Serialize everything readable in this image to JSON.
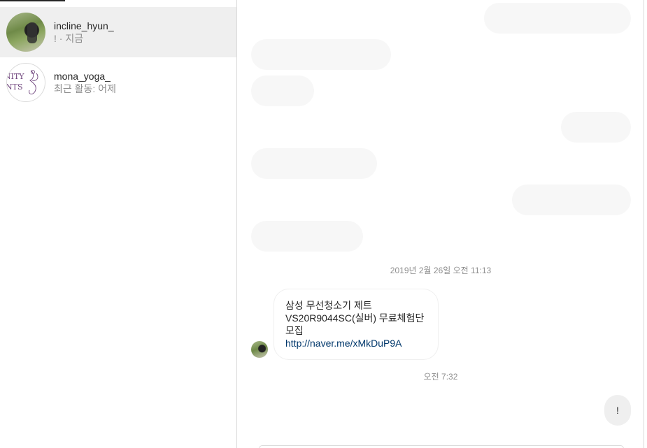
{
  "conversations": [
    {
      "name": "incline_hyun_",
      "status": "! · 지금",
      "avatar_icon": "profile-photo",
      "active": true
    },
    {
      "name": "mona_yoga_",
      "status": "최근 활동: 어제",
      "avatar_icon": "brand-logo",
      "logo_text_line1": "NITY",
      "logo_text_line2": "NTS"
    }
  ],
  "thread": {
    "timestamp_1": "2019년 2월 26일 오전 11:13",
    "incoming_message": {
      "text": "삼성 무선청소기 제트 VS20R9044SC(실버) 무료체험단 모집",
      "link": "http://naver.me/xMkDuP9A"
    },
    "timestamp_2": "오전 7:32",
    "outgoing_message": "!"
  },
  "colors": {
    "active_row": "#efefef",
    "placeholder_bubble": "#f7f7f7",
    "link": "#00376b",
    "secondary_text": "#8e8e8e"
  }
}
